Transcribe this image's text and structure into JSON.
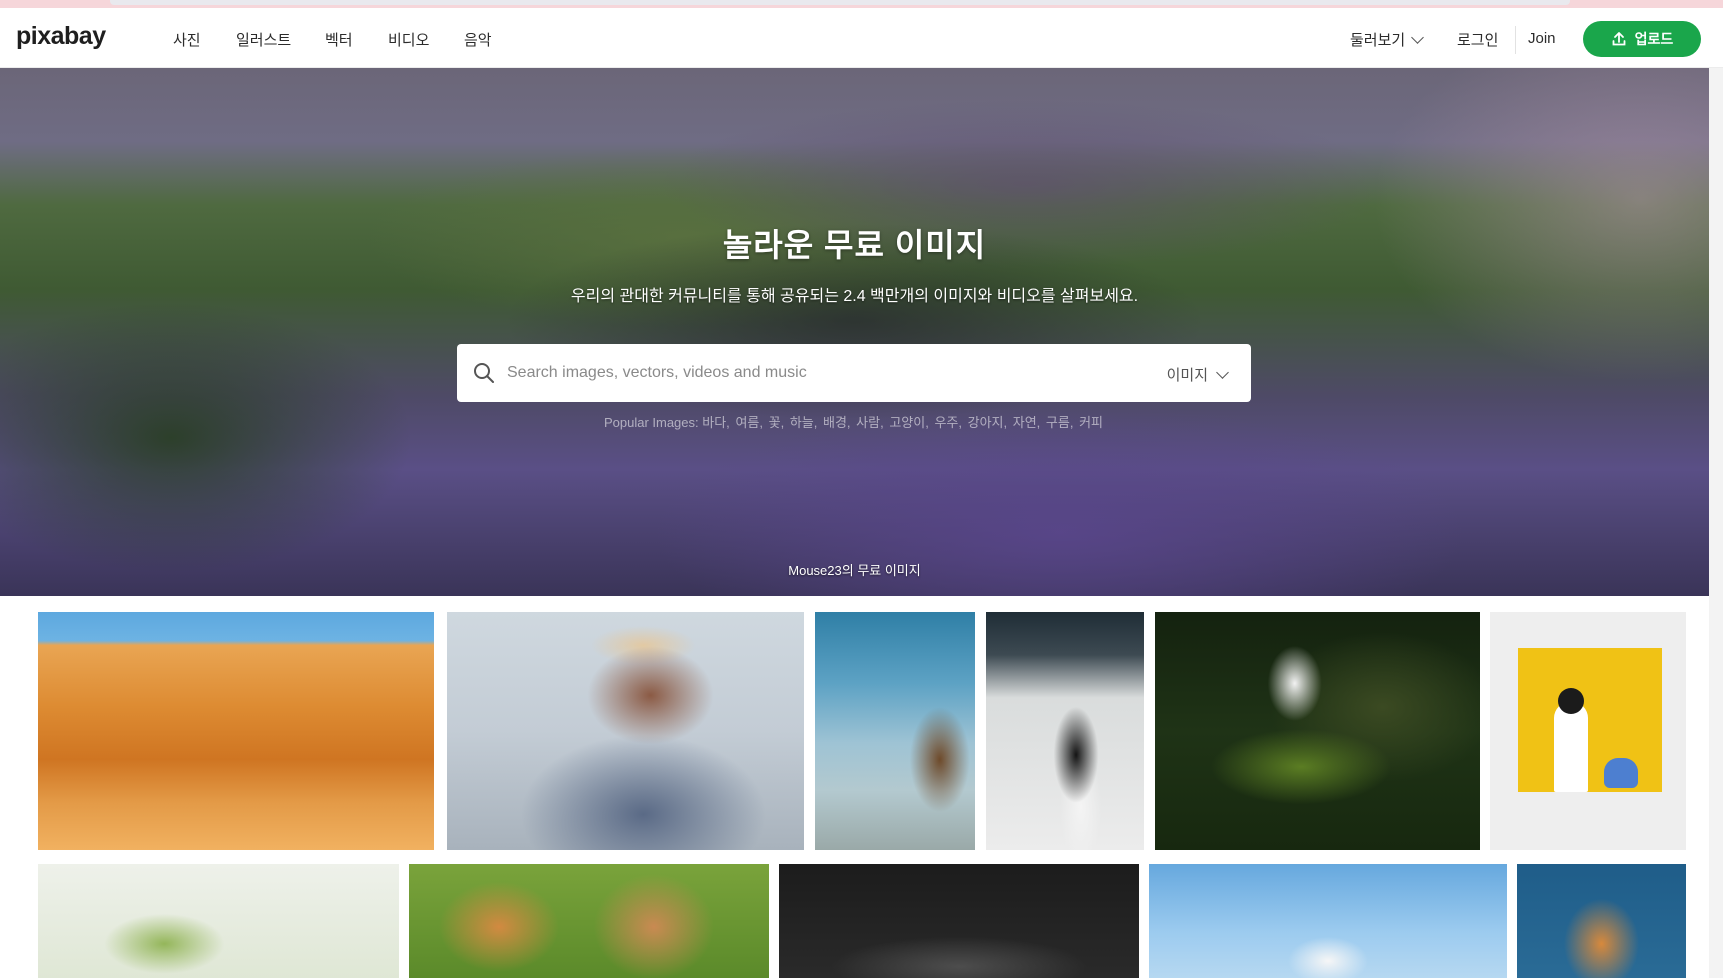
{
  "header": {
    "logo": "pixabay",
    "nav": [
      "사진",
      "일러스트",
      "벡터",
      "비디오",
      "음악"
    ],
    "explore_label": "둘러보기",
    "login_label": "로그인",
    "join_label": "Join",
    "upload_label": "업로드"
  },
  "hero": {
    "title": "놀라운 무료 이미지",
    "subtitle": "우리의 관대한 커뮤니티를 통해 공유되는 2.4 백만개의 이미지와 비디오를 살펴보세요.",
    "search": {
      "placeholder": "Search images, vectors, videos and music",
      "type_label": "이미지"
    },
    "popular_prefix": "Popular Images:",
    "popular_tags": [
      "바다,",
      "여름,",
      "꽃,",
      "하늘,",
      "배경,",
      "사람,",
      "고양이,",
      "우주,",
      "강아지,",
      "자연,",
      "구름,",
      "커피"
    ],
    "credit": "Mouse23의 무료 이미지"
  },
  "colors": {
    "accent": "#1aa64b",
    "text": "#2b2b2b"
  },
  "icons": {
    "search": "search-icon",
    "upload": "upload-icon",
    "chevron": "chevron-down-icon"
  }
}
